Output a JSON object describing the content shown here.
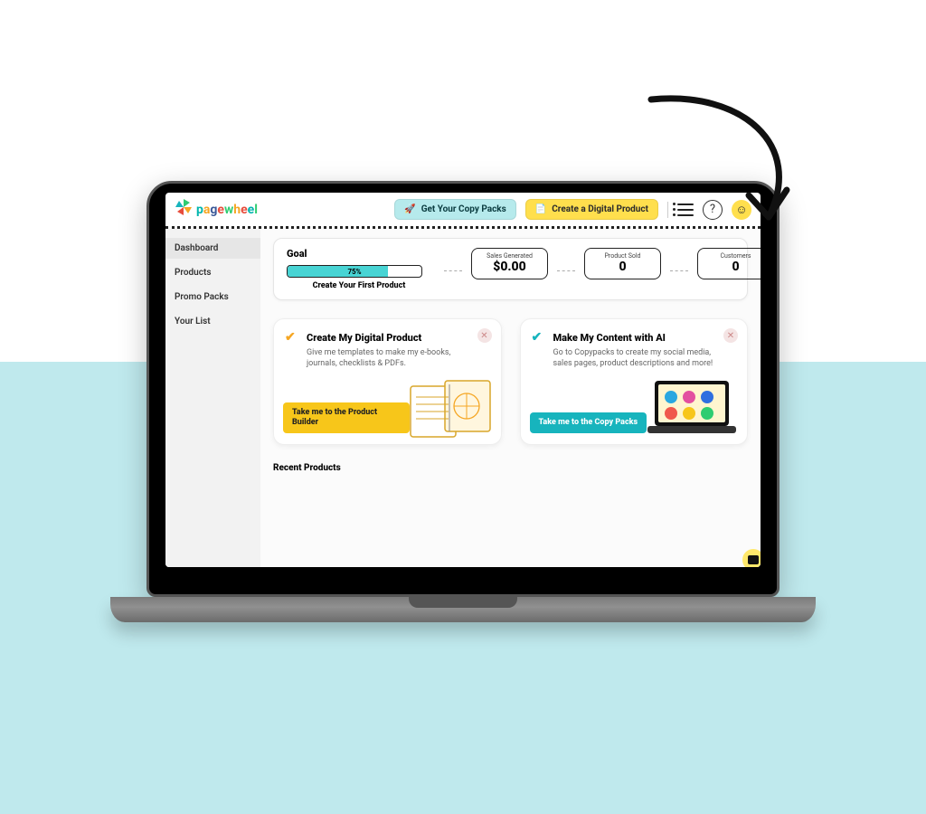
{
  "brand": "pagewheel",
  "topbar": {
    "copy_packs": "Get Your Copy Packs",
    "create_product": "Create a Digital Product"
  },
  "sidebar": {
    "items": [
      {
        "label": "Dashboard",
        "active": true
      },
      {
        "label": "Products",
        "active": false
      },
      {
        "label": "Promo Packs",
        "active": false
      },
      {
        "label": "Your List",
        "active": false
      }
    ]
  },
  "goal": {
    "title": "Goal",
    "progress_pct": "75%",
    "sub": "Create Your First Product",
    "stats": [
      {
        "label": "Sales Generated",
        "value": "$0.00"
      },
      {
        "label": "Product Sold",
        "value": "0"
      },
      {
        "label": "Customers",
        "value": "0"
      }
    ]
  },
  "cards": {
    "product": {
      "title": "Create My Digital Product",
      "desc": "Give me templates to make my e-books, journals, checklists & PDFs.",
      "cta": "Take me to the Product Builder"
    },
    "ai": {
      "title": "Make My Content with AI",
      "desc": "Go to Copypacks to create my social media, sales pages, product descriptions and more!",
      "cta": "Take me to the Copy Packs"
    }
  },
  "recent_title": "Recent Products"
}
